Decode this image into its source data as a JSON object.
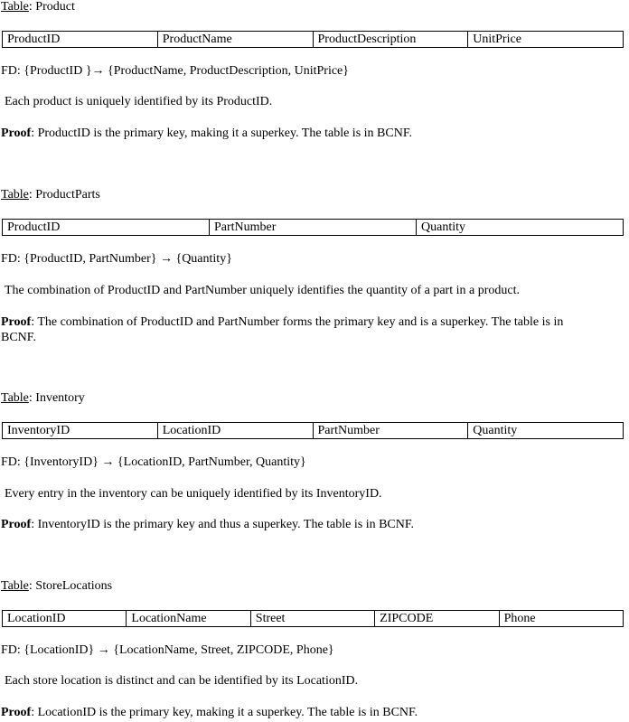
{
  "sections": [
    {
      "table_label": "Table",
      "table_name": "Product",
      "columns": [
        "ProductID",
        "ProductName",
        "ProductDescription",
        "UnitPrice"
      ],
      "fd": "FD: {ProductID }→ {ProductName, ProductDescription, UnitPrice}",
      "explanation": "Each product is uniquely identified by its ProductID.",
      "proof_label": "Proof",
      "proof_text": ": ProductID is the primary key, making it a superkey. The table is in BCNF."
    },
    {
      "table_label": "Table",
      "table_name": "ProductParts",
      "columns": [
        "ProductID",
        "PartNumber",
        "Quantity"
      ],
      "fd": "FD: {ProductID, PartNumber} → {Quantity}",
      "explanation": "The combination of ProductID and PartNumber uniquely identifies the quantity of a part in a product.",
      "proof_label": "Proof",
      "proof_text": ": The combination of ProductID and PartNumber forms the primary key and is a superkey. The table is in BCNF."
    },
    {
      "table_label": "Table",
      "table_name": "Inventory",
      "columns": [
        "InventoryID",
        "LocationID",
        "PartNumber",
        "Quantity"
      ],
      "fd": "FD: {InventoryID} → {LocationID, PartNumber, Quantity}",
      "explanation": "Every entry in the inventory can be uniquely identified by its InventoryID.",
      "proof_label": "Proof",
      "proof_text": ": InventoryID is the primary key and thus a superkey. The table is in BCNF."
    },
    {
      "table_label": "Table",
      "table_name": "StoreLocations",
      "columns": [
        "LocationID",
        "LocationName",
        "Street",
        "ZIPCODE",
        "Phone"
      ],
      "fd": "FD: {LocationID} → {LocationName, Street, ZIPCODE, Phone}",
      "explanation": "Each store location is distinct and can be identified by its LocationID.",
      "proof_label": "Proof",
      "proof_text": ": LocationID is the primary key, making it a superkey. The table is in BCNF."
    }
  ]
}
